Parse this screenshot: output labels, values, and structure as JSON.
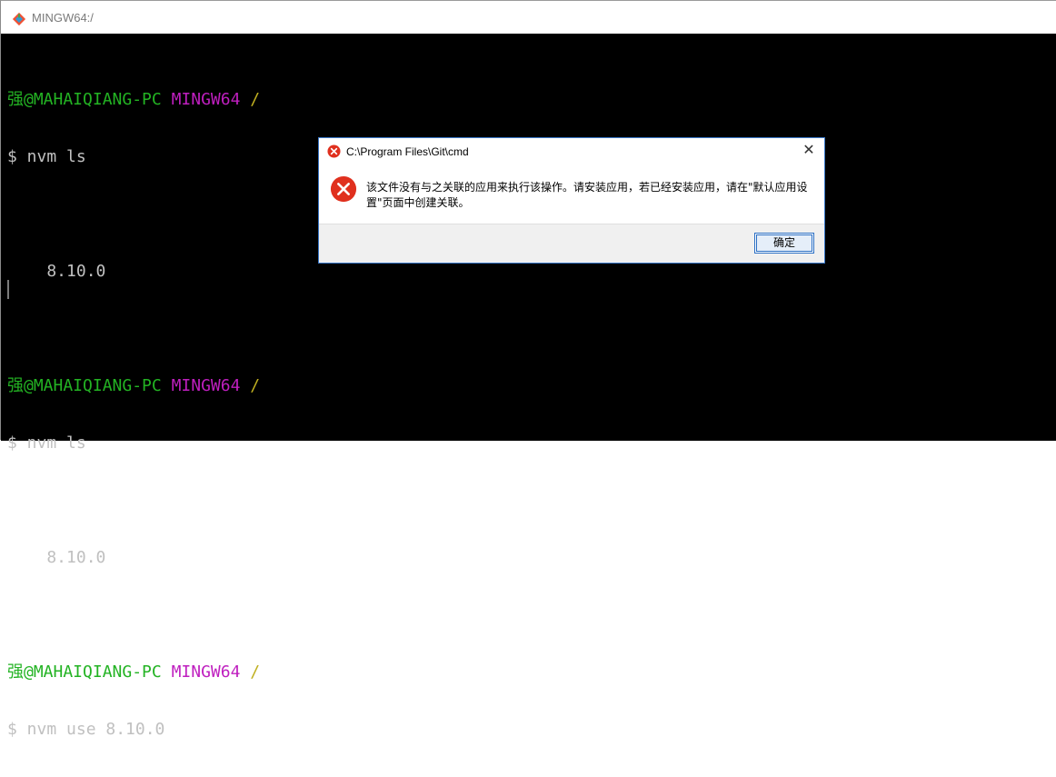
{
  "window": {
    "title": "MINGW64:/"
  },
  "terminal": {
    "lines": [
      {
        "user": "强@MAHAIQIANG-PC",
        "shell": "MINGW64",
        "path": "/"
      },
      {
        "text": "$ nvm ls"
      },
      {
        "text": ""
      },
      {
        "text": "    8.10.0"
      },
      {
        "text": ""
      },
      {
        "user": "强@MAHAIQIANG-PC",
        "shell": "MINGW64",
        "path": "/"
      },
      {
        "text": "$ nvm ls"
      },
      {
        "text": ""
      },
      {
        "text": "    8.10.0"
      },
      {
        "text": ""
      },
      {
        "user": "强@MAHAIQIANG-PC",
        "shell": "MINGW64",
        "path": "/"
      },
      {
        "text": "$ nvm use 8.10.0"
      }
    ]
  },
  "dialog": {
    "caption": "C:\\Program Files\\Git\\cmd",
    "close_glyph": "✕",
    "message_line1": "该文件没有与之关联的应用来执行该操作。请安装应用，若已经安装应用，请在\"默认应用设",
    "message_line2": "置\"页面中创建关联。",
    "ok_label": "确定"
  },
  "colors": {
    "prompt_user": "#23b323",
    "prompt_shell": "#bf1fbf",
    "prompt_path": "#c0b020",
    "error_red": "#e0301e"
  }
}
